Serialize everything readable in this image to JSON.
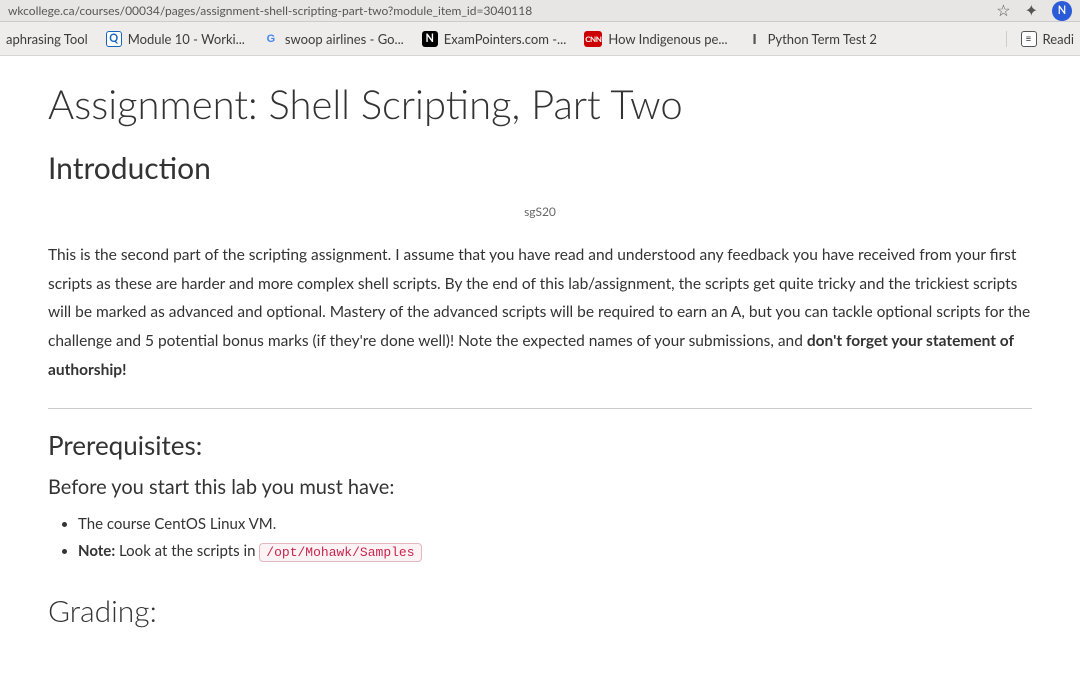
{
  "address_bar": {
    "url_fragment": "wkcollege.ca/courses/00034/pages/assignment-shell-scripting-part-two?module_item_id=3040118"
  },
  "bookmarks": {
    "items": [
      {
        "label": "aphrasing Tool"
      },
      {
        "label": "Module 10 - Worki..."
      },
      {
        "label": "swoop airlines - Go..."
      },
      {
        "label": "ExamPointers.com -..."
      },
      {
        "label": "How Indigenous pe..."
      },
      {
        "label": "Python Term Test 2"
      }
    ],
    "reading_list": "Readi"
  },
  "page": {
    "title": "Assignment: Shell Scripting, Part Two",
    "intro_heading": "Introduction",
    "tag": "sgS20",
    "intro_body_prefix": "This is the second part of the scripting assignment. I assume that you have read and understood any feedback you have received from your first scripts as these are harder and more complex shell scripts. By the end of this lab/assignment, the scripts get quite tricky and the trickiest scripts will be marked as advanced and optional. Mastery of the advanced scripts will be required to earn an A, but you can tackle optional scripts for the challenge and 5 potential bonus marks (if they're done well)!  Note the expected names of your submissions, and ",
    "intro_body_bold": "don't forget your statement of authorship!",
    "prereq_heading": "Prerequisites:",
    "prereq_sub": "Before you start this lab you must have:",
    "prereq_items": {
      "i0": "The course CentOS Linux VM.",
      "i1_prefix": "Note:",
      "i1_rest": " Look at the scripts in ",
      "i1_code": "/opt/Mohawk/Samples"
    },
    "cutoff_heading": "Grading:"
  }
}
